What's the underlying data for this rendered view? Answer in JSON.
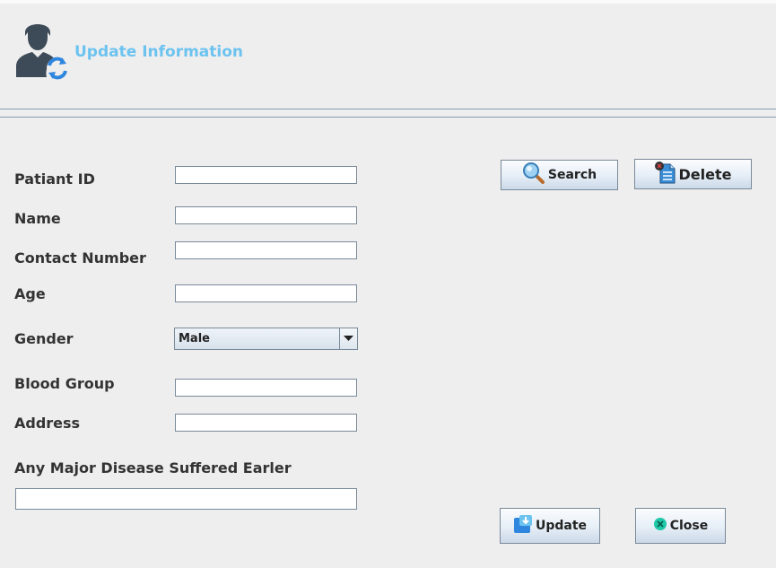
{
  "header": {
    "title": "Update Information",
    "icon": "user-refresh-icon"
  },
  "form": {
    "patient_id_label": "Patiant ID",
    "name_label": "Name",
    "contact_label": "Contact Number",
    "age_label": "Age",
    "gender_label": "Gender",
    "gender_value": "Male",
    "blood_group_label": "Blood Group",
    "address_label": "Address",
    "disease_label": "Any Major Disease Suffered Earler",
    "patient_id_value": "",
    "name_value": "",
    "contact_value": "",
    "age_value": "",
    "blood_group_value": "",
    "address_value": "",
    "disease_value": ""
  },
  "buttons": {
    "search": "Search",
    "delete": "Delete",
    "update": "Update",
    "close": "Close"
  },
  "icons": {
    "search": "magnifier-icon",
    "delete": "document-delete-icon",
    "update": "save-download-icon",
    "close": "close-circle-icon"
  },
  "colors": {
    "title": "#6cc3f0",
    "background": "#eeeeee",
    "accent_blue": "#2e86de",
    "close_teal": "#1ec8a8"
  }
}
